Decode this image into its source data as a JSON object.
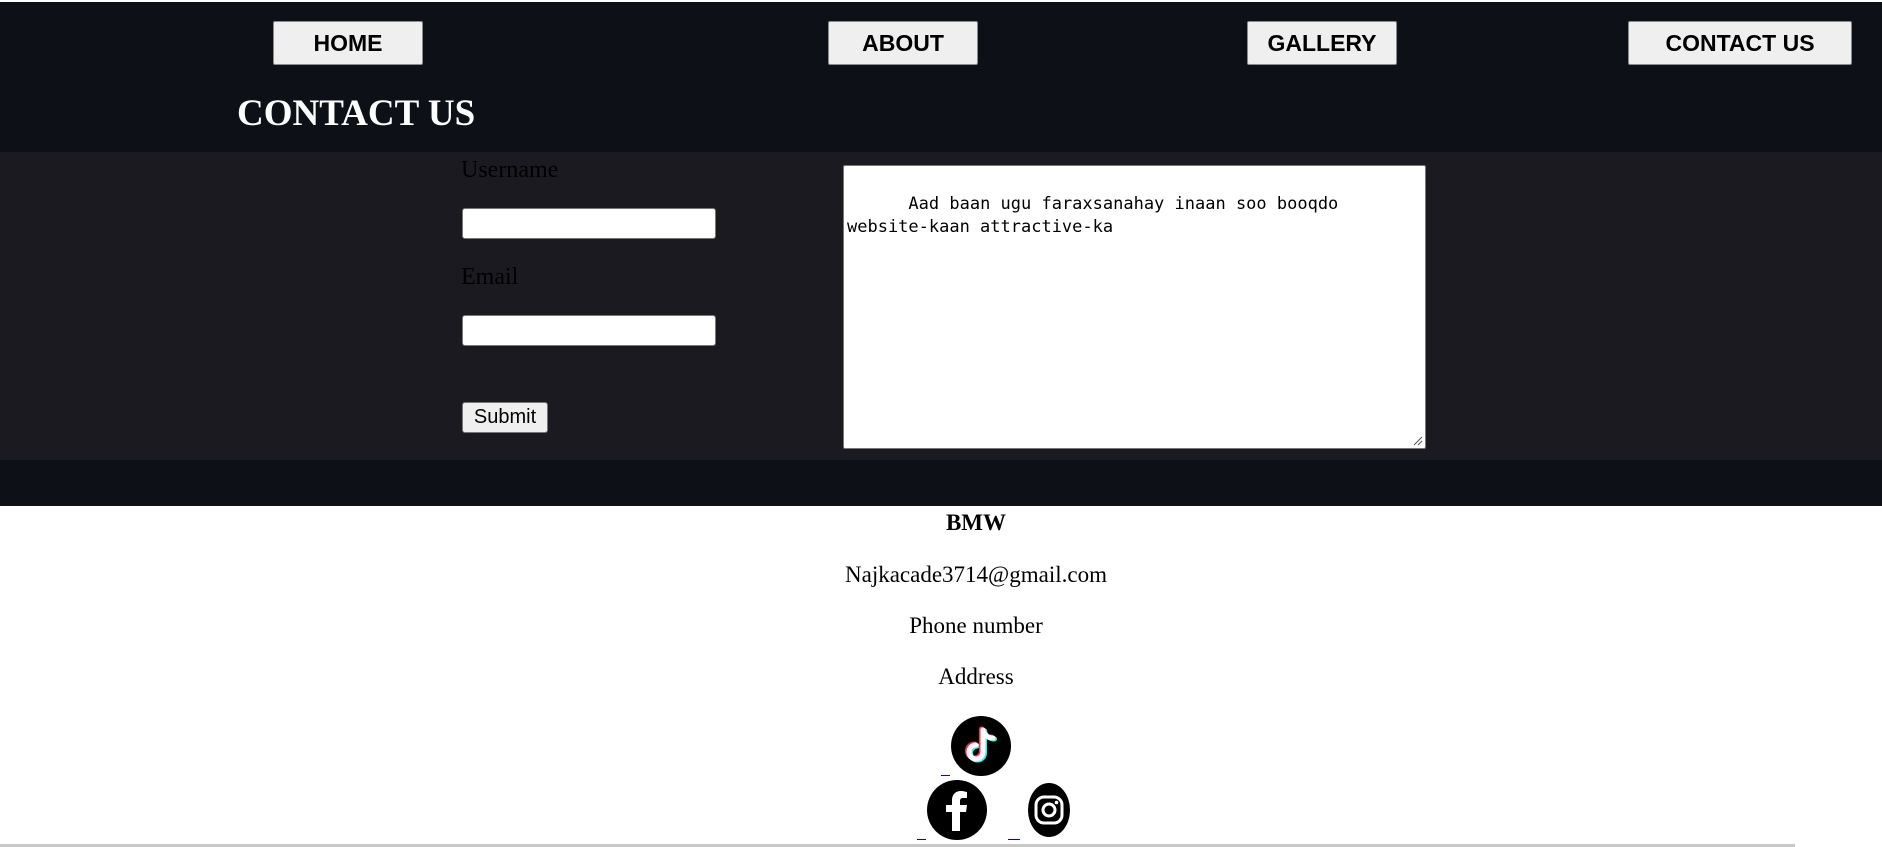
{
  "nav": {
    "home": "HOME",
    "about": "ABOUT",
    "gallery": "GALLERY",
    "contact": "CONTACT US"
  },
  "page_title": "CONTACT US",
  "form": {
    "username_label": "Username",
    "username_value": "",
    "email_label": "Email",
    "email_value": "",
    "submit_label": "Submit",
    "message_value": "    Aad baan ugu faraxsanahay inaan soo booqdo website-kaan attractive-ka"
  },
  "footer": {
    "brand": "BMW",
    "email": "Najkacade3714@gmail.com",
    "phone": "Phone number",
    "address": "Address"
  },
  "icons": {
    "tiktok": "tiktok-icon",
    "facebook": "facebook-icon",
    "instagram": "instagram-icon"
  },
  "colors": {
    "header_bg": "#0d1117",
    "form_bg": "#1b1a20",
    "button_bg": "#efefef",
    "title_text": "#ffffff"
  }
}
